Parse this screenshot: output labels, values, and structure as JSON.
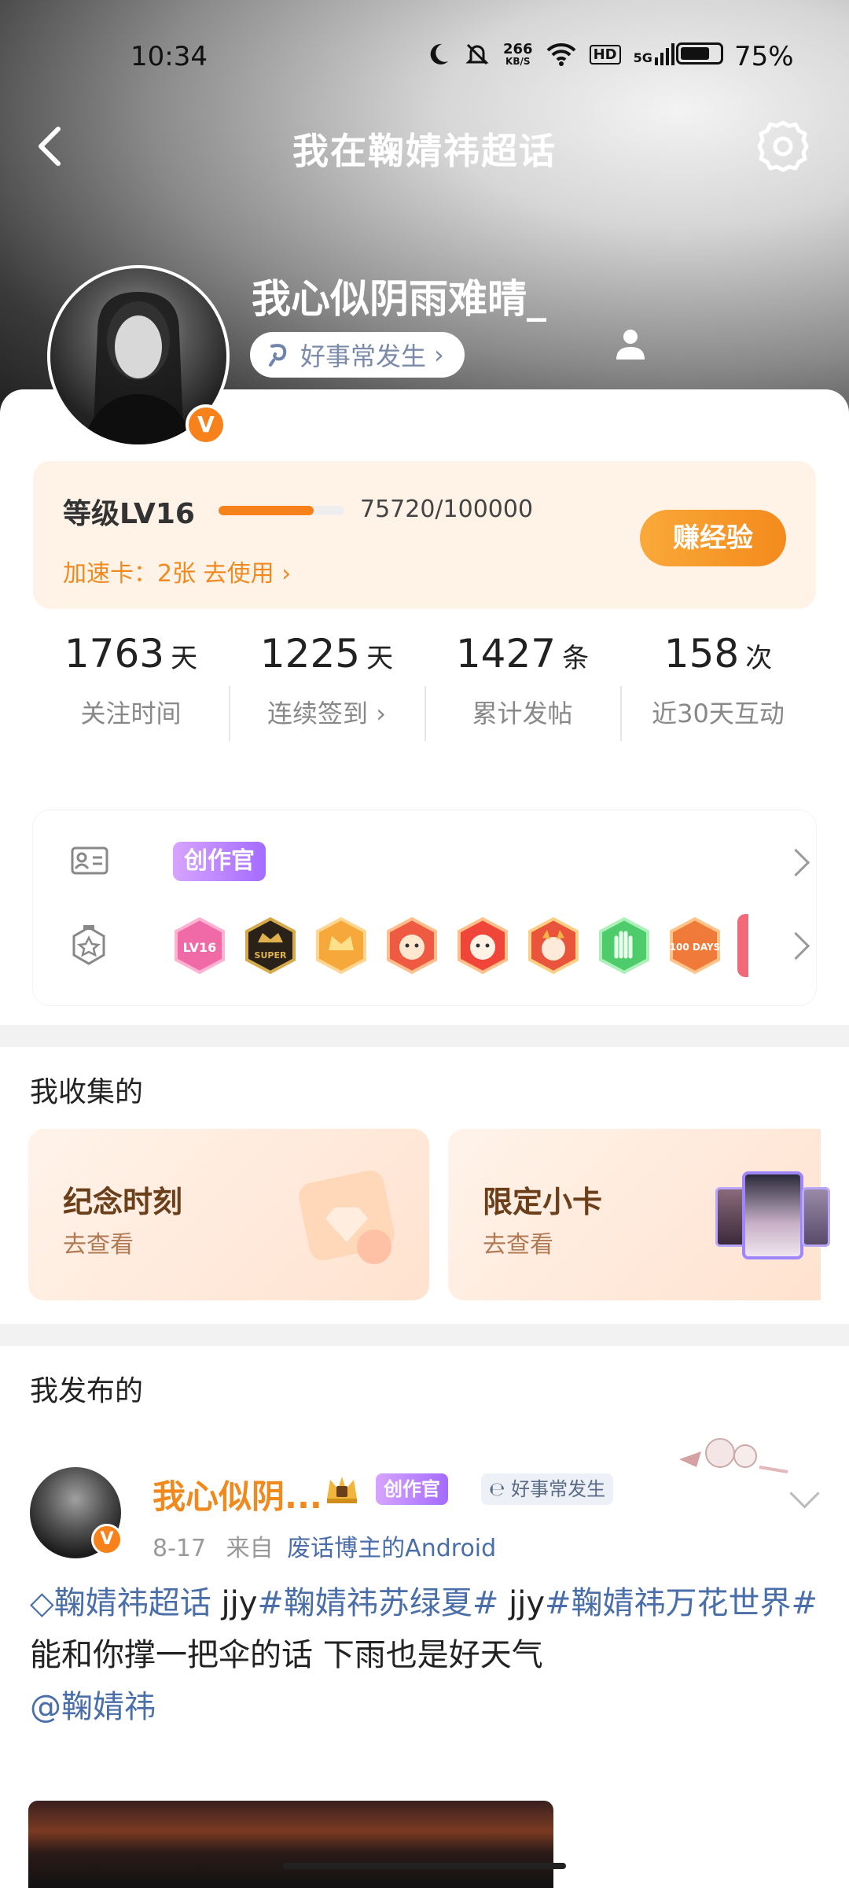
{
  "status_bar": {
    "time": "10:34",
    "net_speed": "266",
    "net_unit": "KB/S",
    "hd": "HD",
    "signal": "5G",
    "battery_level": 0.75,
    "battery": "75%"
  },
  "nav": {
    "title": "我在鞠婧祎超话"
  },
  "profile": {
    "name": "我心似阴雨难晴_",
    "tag": "好事常发生"
  },
  "level": {
    "label": "等级LV16",
    "exp": "75720/100000",
    "progress": 0.7572,
    "speed_card": "加速卡：2张 去使用",
    "earn_button": "赚经验"
  },
  "stats": [
    {
      "value": "1763",
      "unit": "天",
      "label": "关注时间"
    },
    {
      "value": "1225",
      "unit": "天",
      "label": "连续签到"
    },
    {
      "value": "1427",
      "unit": "条",
      "label": "累计发帖"
    },
    {
      "value": "158",
      "unit": "次",
      "label": "近30天互动"
    }
  ],
  "badges": {
    "creator": "创作官",
    "medals": [
      "LV16",
      "SUPER",
      "",
      "",
      "",
      "",
      "",
      "100 DAYS"
    ]
  },
  "collected": {
    "title": "我收集的",
    "cards": [
      {
        "title": "纪念时刻",
        "sub": "去查看"
      },
      {
        "title": "限定小卡",
        "sub": "去查看"
      }
    ]
  },
  "posted": {
    "title": "我发布的"
  },
  "post": {
    "author": "我心似阴...",
    "creator_badge": "创作官",
    "tag": "好事常发生",
    "date": "8-17",
    "from": "来自",
    "source": "废话博主的Android",
    "topic": "鞠婧祎超话",
    "t1": " jjy",
    "hashtag1": "#鞠婧祎苏绿夏#",
    "t2": " jjy",
    "hashtag2": "#鞠婧祎万花世界#",
    "text": "能和你撑一把伞的话 下雨也是好天气",
    "mention": "@鞠婧祎"
  },
  "colors": {
    "accent": "#f7821c",
    "link": "#4a6ea9"
  }
}
